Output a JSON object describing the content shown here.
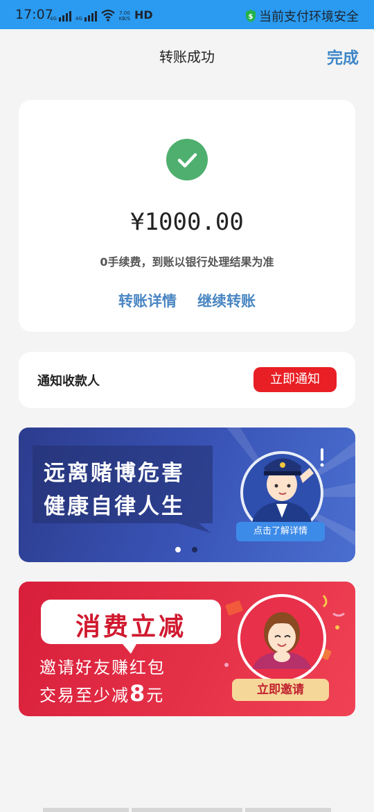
{
  "status_bar": {
    "time": "17:07",
    "signal1_label": "4G",
    "signal2_label": "4G",
    "speed_value": "7.00",
    "speed_unit": "KB/S",
    "hd_label": "HD",
    "safe_text": "当前支付环境安全",
    "icons": [
      "signal-icon",
      "signal-icon",
      "wifi-icon",
      "shield-dollar-icon"
    ]
  },
  "nav": {
    "title": "转账成功",
    "done_label": "完成"
  },
  "result": {
    "icon": "check-icon",
    "amount": "¥1000.00",
    "fee_note": "0手续费，到账以银行处理结果为准",
    "detail_link": "转账详情",
    "continue_link": "继续转账"
  },
  "notify": {
    "label": "通知收款人",
    "button": "立即通知"
  },
  "banner1": {
    "line1": "远离赌博危害",
    "line2": "健康自律人生",
    "cta": "点击了解详情",
    "active_dot": 0,
    "dot_count": 2
  },
  "banner2": {
    "title": "消费立减",
    "line1": "邀请好友赚红包",
    "line2_prefix": "交易至少减",
    "line2_number": "8",
    "line2_suffix": "元",
    "button": "立即邀请"
  },
  "colors": {
    "status_bar": "#2a9bf0",
    "link_blue": "#4a86c2",
    "success_green": "#4faf6e",
    "notify_red": "#e81f25"
  }
}
